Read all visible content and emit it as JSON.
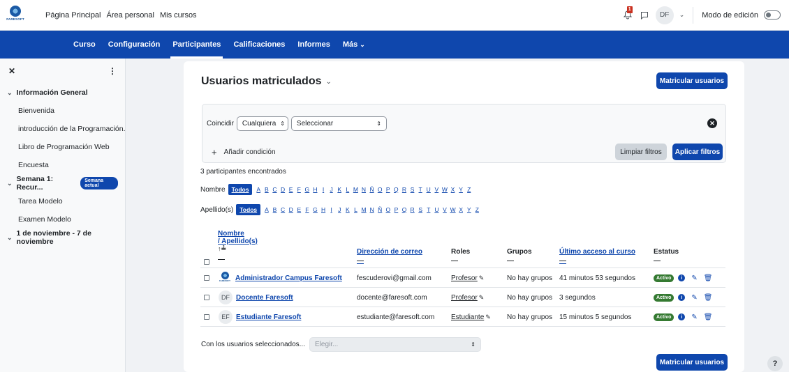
{
  "brand": {
    "logo_text": "FARESOFT"
  },
  "topnav": [
    "Página Principal",
    "Área personal",
    "Mis cursos"
  ],
  "user": {
    "notif_count": "1",
    "initials": "DF",
    "edit_mode_label": "Modo de edición"
  },
  "course_tabs": [
    "Curso",
    "Configuración",
    "Participantes",
    "Calificaciones",
    "Informes",
    "Más"
  ],
  "drawer": {
    "sections": [
      {
        "title": "Información General",
        "items": [
          "Bienvenida",
          "introducción de la Programación...",
          "Libro de Programación Web",
          "Encuesta"
        ]
      },
      {
        "title": "Semana 1: Recur...",
        "badge": "Semana actual",
        "items": [
          "Tarea Modelo",
          "Examen Modelo"
        ]
      },
      {
        "title": "1 de noviembre - 7 de noviembre",
        "items": []
      }
    ]
  },
  "page": {
    "title": "Usuarios matriculados",
    "enrol_button": "Matricular usuarios",
    "filter": {
      "match_label": "Coincidir",
      "match_value": "Cualquiera",
      "select_value": "Seleccionar",
      "add_condition": "Añadir condición",
      "clear_button": "Limpiar filtros",
      "apply_button": "Aplicar filtros"
    },
    "found_text": "3 participantes encontrados",
    "name_filter_label": "Nombre",
    "surname_filter_label": "Apellido(s)",
    "all_label": "Todos",
    "letters": [
      "A",
      "B",
      "C",
      "D",
      "E",
      "F",
      "G",
      "H",
      "I",
      "J",
      "K",
      "L",
      "M",
      "N",
      "Ñ",
      "O",
      "P",
      "Q",
      "R",
      "S",
      "T",
      "U",
      "V",
      "W",
      "X",
      "Y",
      "Z"
    ],
    "columns": {
      "name": "Nombre",
      "surname": "/ Apellido(s)",
      "sort_icon": "↑≟",
      "email": "Dirección de correo",
      "roles": "Roles",
      "groups": "Grupos",
      "last_access": "Último acceso al curso",
      "status": "Estatus"
    },
    "rows": [
      {
        "avatar": "logo",
        "name": "Administrador Campus Faresoft",
        "email": "fescuderovi@gmail.com",
        "role": "Profesor",
        "groups": "No hay grupos",
        "last_access": "41 minutos 53 segundos",
        "status": "Activo"
      },
      {
        "avatar": "DF",
        "name": "Docente Faresoft",
        "email": "docente@faresoft.com",
        "role": "Profesor",
        "groups": "No hay grupos",
        "last_access": "3 segundos",
        "status": "Activo"
      },
      {
        "avatar": "EF",
        "name": "Estudiante Faresoft",
        "email": "estudiante@faresoft.com",
        "role": "Estudiante",
        "groups": "No hay grupos",
        "last_access": "15 minutos 5 segundos",
        "status": "Activo"
      }
    ],
    "bulk_label": "Con los usuarios seleccionados...",
    "bulk_placeholder": "Elegir..."
  },
  "help_label": "?"
}
